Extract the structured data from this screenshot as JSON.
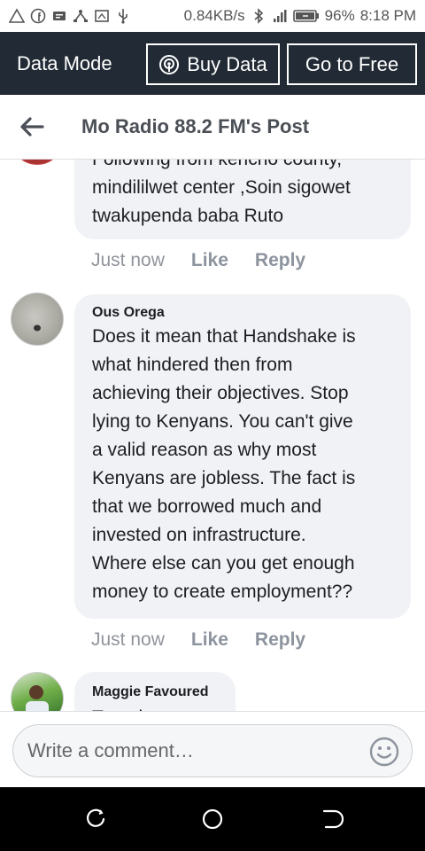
{
  "status_bar": {
    "net_speed": "0.84KB/s",
    "battery": "96%",
    "time": "8:18 PM"
  },
  "data_bar": {
    "mode_label": "Data Mode",
    "buy_label": "Buy Data",
    "free_label": "Go to Free"
  },
  "header": {
    "title": "Mo Radio 88.2 FM's Post"
  },
  "comments": [
    {
      "text": "Following from kericho county,\nmindililwet center ,Soin sigowet\ntwakupenda baba Ruto",
      "time": "Just now",
      "like": "Like",
      "reply": "Reply"
    },
    {
      "author": "Ous Orega",
      "text": "Does it mean that Handshake is\nwhat hindered then from\nachieving their objectives. Stop\nlying to Kenyans. You can't give\na valid reason as why most\nKenyans are jobless. The fact is\nthat we borrowed much and\ninvested on infrastructure.\nWhere else can you get enough\nmoney to create employment??",
      "time": "Just now",
      "like": "Like",
      "reply": "Reply"
    },
    {
      "author": "Maggie Favoured",
      "text": "Tyrr sh"
    }
  ],
  "composer": {
    "placeholder": "Write a comment…"
  },
  "colors": {
    "data_bar_bg": "#222b35",
    "bubble_bg": "#f0f2f5",
    "muted_text": "#90949c"
  }
}
